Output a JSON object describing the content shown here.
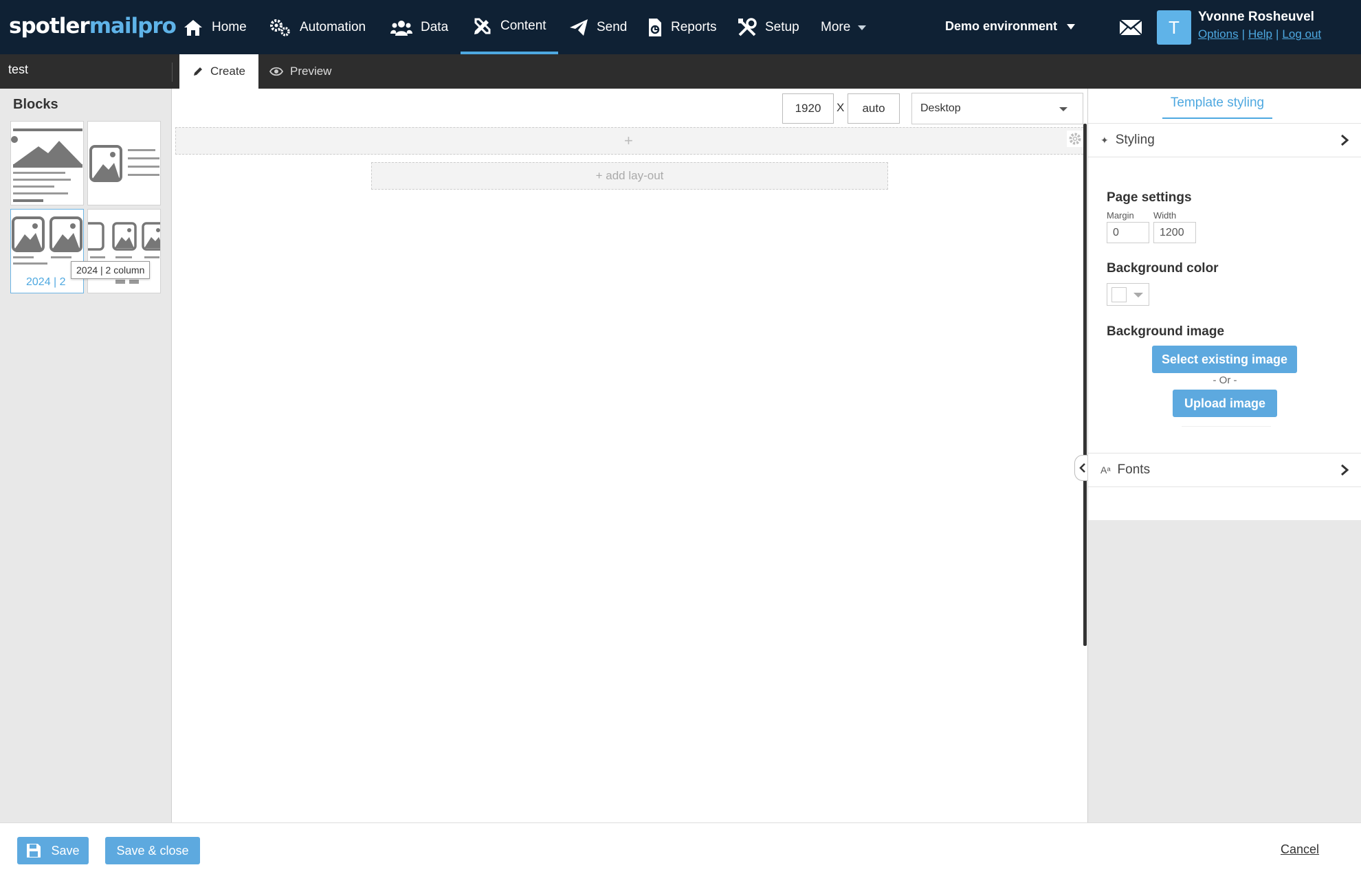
{
  "brand": {
    "logo_part1": "spotler",
    "logo_part2": "mailpro",
    "accent": "#4ea8e0",
    "nav_bg": "#0f2134"
  },
  "nav": {
    "items": [
      {
        "label": "Home",
        "icon": "home-icon"
      },
      {
        "label": "Automation",
        "icon": "gears-icon"
      },
      {
        "label": "Data",
        "icon": "users-icon"
      },
      {
        "label": "Content",
        "icon": "pencil-ruler-icon",
        "active": true
      },
      {
        "label": "Send",
        "icon": "paper-plane-icon"
      },
      {
        "label": "Reports",
        "icon": "report-file-icon"
      },
      {
        "label": "Setup",
        "icon": "tools-icon"
      },
      {
        "label": "More",
        "icon": "caret-down-icon"
      }
    ],
    "environment": "Demo environment"
  },
  "user": {
    "avatar_letter": "T",
    "name": "Yvonne Rosheuvel",
    "links": [
      "Options",
      "Help",
      "Log out"
    ]
  },
  "subbar": {
    "document_title": "test",
    "tabs": [
      "Create",
      "Preview"
    ]
  },
  "blocks": {
    "title": "Blocks",
    "selected_label": "2024 | 2",
    "tooltip": "2024 | 2 column"
  },
  "canvas": {
    "width_value": "1920",
    "separator": "X",
    "height_value": "auto",
    "view_mode": "Desktop",
    "add_row": "+",
    "add_layout": "+ add lay-out"
  },
  "right_panel": {
    "tab": "Template styling",
    "styling_label": "Styling",
    "page_settings": "Page settings",
    "margin_label": "Margin",
    "margin_value": "0",
    "width_label": "Width",
    "width_value": "1200",
    "bg_color_label": "Background color",
    "bg_image_label": "Background image",
    "select_image": "Select existing image",
    "or": "- Or -",
    "upload_image": "Upload image",
    "fonts_label": "Fonts"
  },
  "footer": {
    "save": "Save",
    "save_close": "Save & close",
    "cancel": "Cancel"
  }
}
